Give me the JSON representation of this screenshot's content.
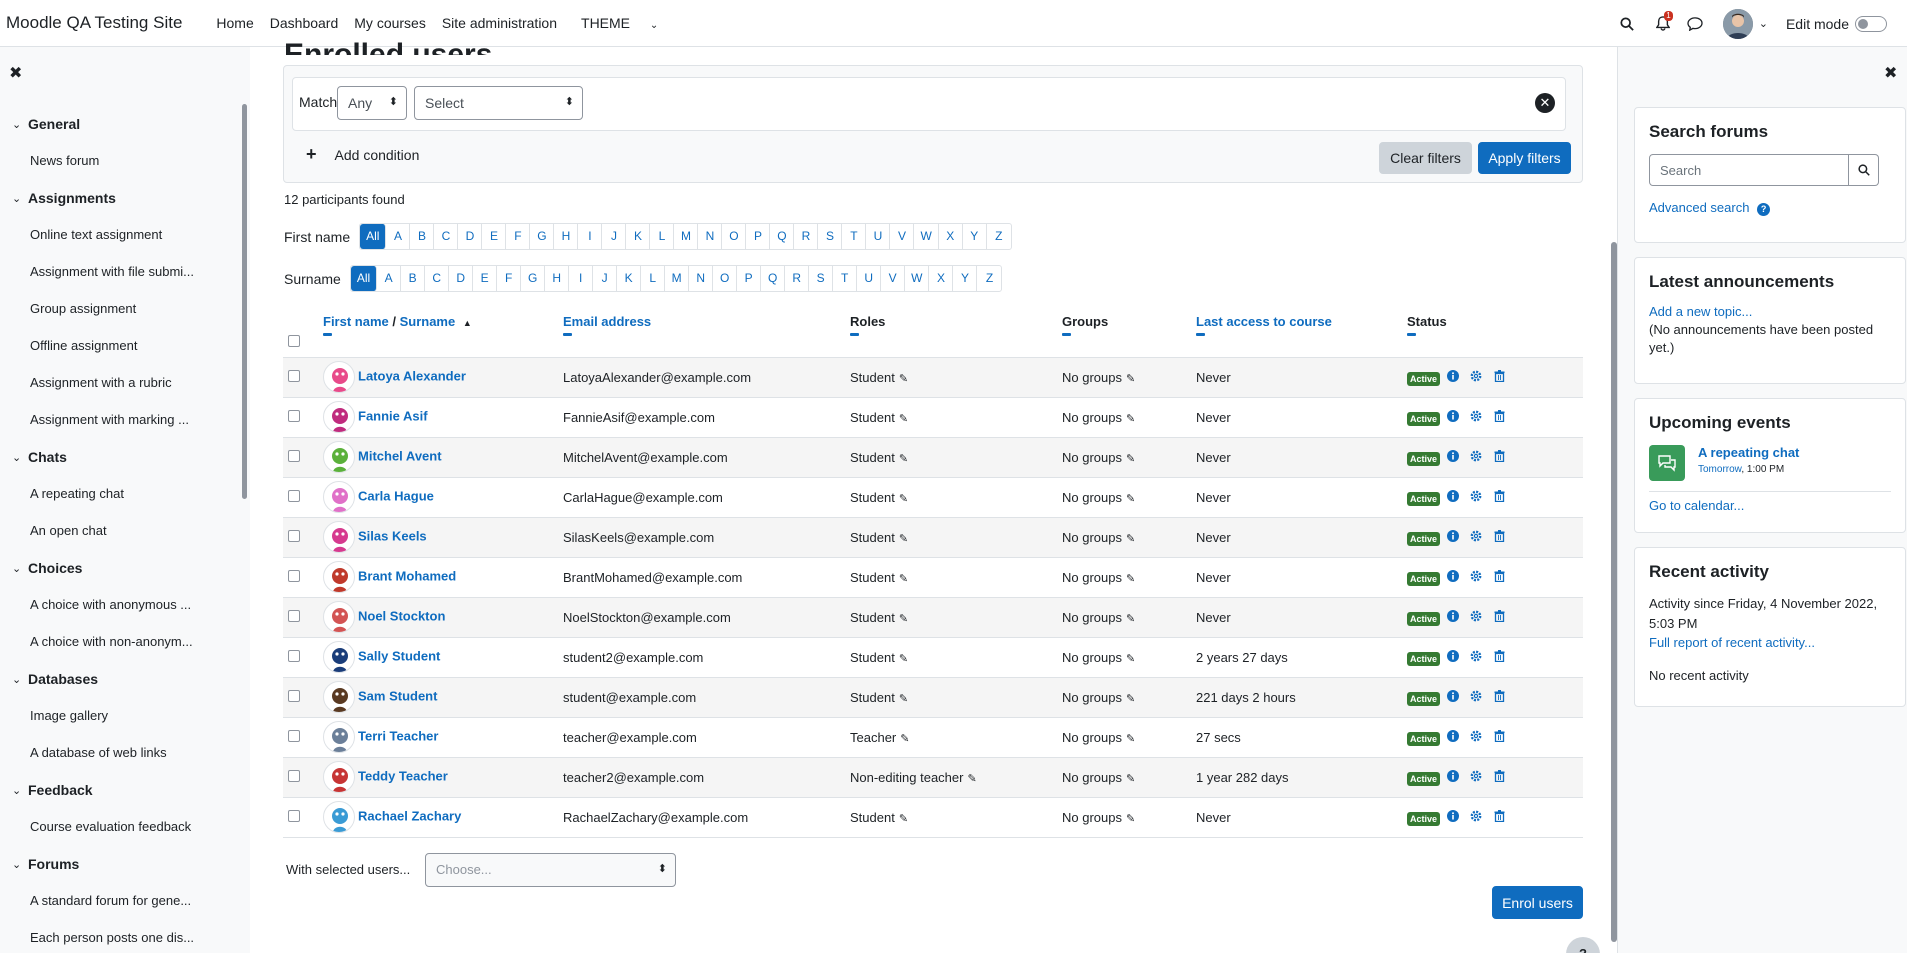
{
  "site_name": "Moodle QA Testing Site",
  "nav": [
    "Home",
    "Dashboard",
    "My courses",
    "Site administration",
    "THEME"
  ],
  "notif_count": "1",
  "edit_mode": "Edit mode",
  "page_heading": "Enrolled users",
  "left_nav": [
    {
      "section": "General",
      "items": [
        "News forum"
      ]
    },
    {
      "section": "Assignments",
      "items": [
        "Online text assignment",
        "Assignment with file submi...",
        "Group assignment",
        "Offline assignment",
        "Assignment with a rubric",
        "Assignment with marking ..."
      ]
    },
    {
      "section": "Chats",
      "items": [
        "A repeating chat",
        "An open chat"
      ]
    },
    {
      "section": "Choices",
      "items": [
        "A choice with anonymous ...",
        "A choice with non-anonym..."
      ]
    },
    {
      "section": "Databases",
      "items": [
        "Image gallery",
        "A database of web links"
      ]
    },
    {
      "section": "Feedback",
      "items": [
        "Course evaluation feedback"
      ]
    },
    {
      "section": "Forums",
      "items": [
        "A standard forum for gene...",
        "Each person posts one dis..."
      ]
    }
  ],
  "filter": {
    "match_label": "Match",
    "match_value": "Any",
    "select_value": "Select",
    "add_condition": "Add condition",
    "clear": "Clear filters",
    "apply": "Apply filters"
  },
  "participants_found": "12 participants found",
  "firstname_label": "First name",
  "surname_label": "Surname",
  "letters_all": "All",
  "letters": [
    "A",
    "B",
    "C",
    "D",
    "E",
    "F",
    "G",
    "H",
    "I",
    "J",
    "K",
    "L",
    "M",
    "N",
    "O",
    "P",
    "Q",
    "R",
    "S",
    "T",
    "U",
    "V",
    "W",
    "X",
    "Y",
    "Z"
  ],
  "columns": {
    "first_name": "First name",
    "sep": " / ",
    "surname": "Surname",
    "email": "Email address",
    "roles": "Roles",
    "groups": "Groups",
    "last_access": "Last access to course",
    "status": "Status"
  },
  "rows": [
    {
      "name": "Latoya Alexander",
      "email": "LatoyaAlexander@example.com",
      "role": "Student",
      "groups": "No groups",
      "access": "Never",
      "status": "Active",
      "avatar_color": "#e84a8a"
    },
    {
      "name": "Fannie Asif",
      "email": "FannieAsif@example.com",
      "role": "Student",
      "groups": "No groups",
      "access": "Never",
      "status": "Active",
      "avatar_color": "#c02b7e"
    },
    {
      "name": "Mitchel Avent",
      "email": "MitchelAvent@example.com",
      "role": "Student",
      "groups": "No groups",
      "access": "Never",
      "status": "Active",
      "avatar_color": "#5bb13b"
    },
    {
      "name": "Carla Hague",
      "email": "CarlaHague@example.com",
      "role": "Student",
      "groups": "No groups",
      "access": "Never",
      "status": "Active",
      "avatar_color": "#e070c8"
    },
    {
      "name": "Silas Keels",
      "email": "SilasKeels@example.com",
      "role": "Student",
      "groups": "No groups",
      "access": "Never",
      "status": "Active",
      "avatar_color": "#d63a8f"
    },
    {
      "name": "Brant Mohamed",
      "email": "BrantMohamed@example.com",
      "role": "Student",
      "groups": "No groups",
      "access": "Never",
      "status": "Active",
      "avatar_color": "#c0392b"
    },
    {
      "name": "Noel Stockton",
      "email": "NoelStockton@example.com",
      "role": "Student",
      "groups": "No groups",
      "access": "Never",
      "status": "Active",
      "avatar_color": "#d35454"
    },
    {
      "name": "Sally Student",
      "email": "student2@example.com",
      "role": "Student",
      "groups": "No groups",
      "access": "2 years 27 days",
      "status": "Active",
      "avatar_color": "#1a3d7a"
    },
    {
      "name": "Sam Student",
      "email": "student@example.com",
      "role": "Student",
      "groups": "No groups",
      "access": "221 days 2 hours",
      "status": "Active",
      "avatar_color": "#5a3a22"
    },
    {
      "name": "Terri Teacher",
      "email": "teacher@example.com",
      "role": "Teacher",
      "groups": "No groups",
      "access": "27 secs",
      "status": "Active",
      "avatar_color": "#6b7f99"
    },
    {
      "name": "Teddy Teacher",
      "email": "teacher2@example.com",
      "role": "Non-editing teacher",
      "groups": "No groups",
      "access": "1 year 282 days",
      "status": "Active",
      "avatar_color": "#c73434"
    },
    {
      "name": "Rachael Zachary",
      "email": "RachaelZachary@example.com",
      "role": "Student",
      "groups": "No groups",
      "access": "Never",
      "status": "Active",
      "avatar_color": "#3a9bd5"
    }
  ],
  "with_selected": "With selected users...",
  "choose": "Choose...",
  "enrol": "Enrol users",
  "blocks": {
    "search_forums": {
      "title": "Search forums",
      "placeholder": "Search",
      "advanced": "Advanced search"
    },
    "latest_announcements": {
      "title": "Latest announcements",
      "add": "Add a new topic...",
      "none": "(No announcements have been posted yet.)"
    },
    "upcoming_events": {
      "title": "Upcoming events",
      "event": "A repeating chat",
      "when_day": "Tomorrow",
      "when_time": ", 1:00 PM",
      "calendar": "Go to calendar..."
    },
    "recent_activity": {
      "title": "Recent activity",
      "since": "Activity since Friday, 4 November 2022, 5:03 PM",
      "full": "Full report of recent activity...",
      "none": "No recent activity"
    }
  }
}
